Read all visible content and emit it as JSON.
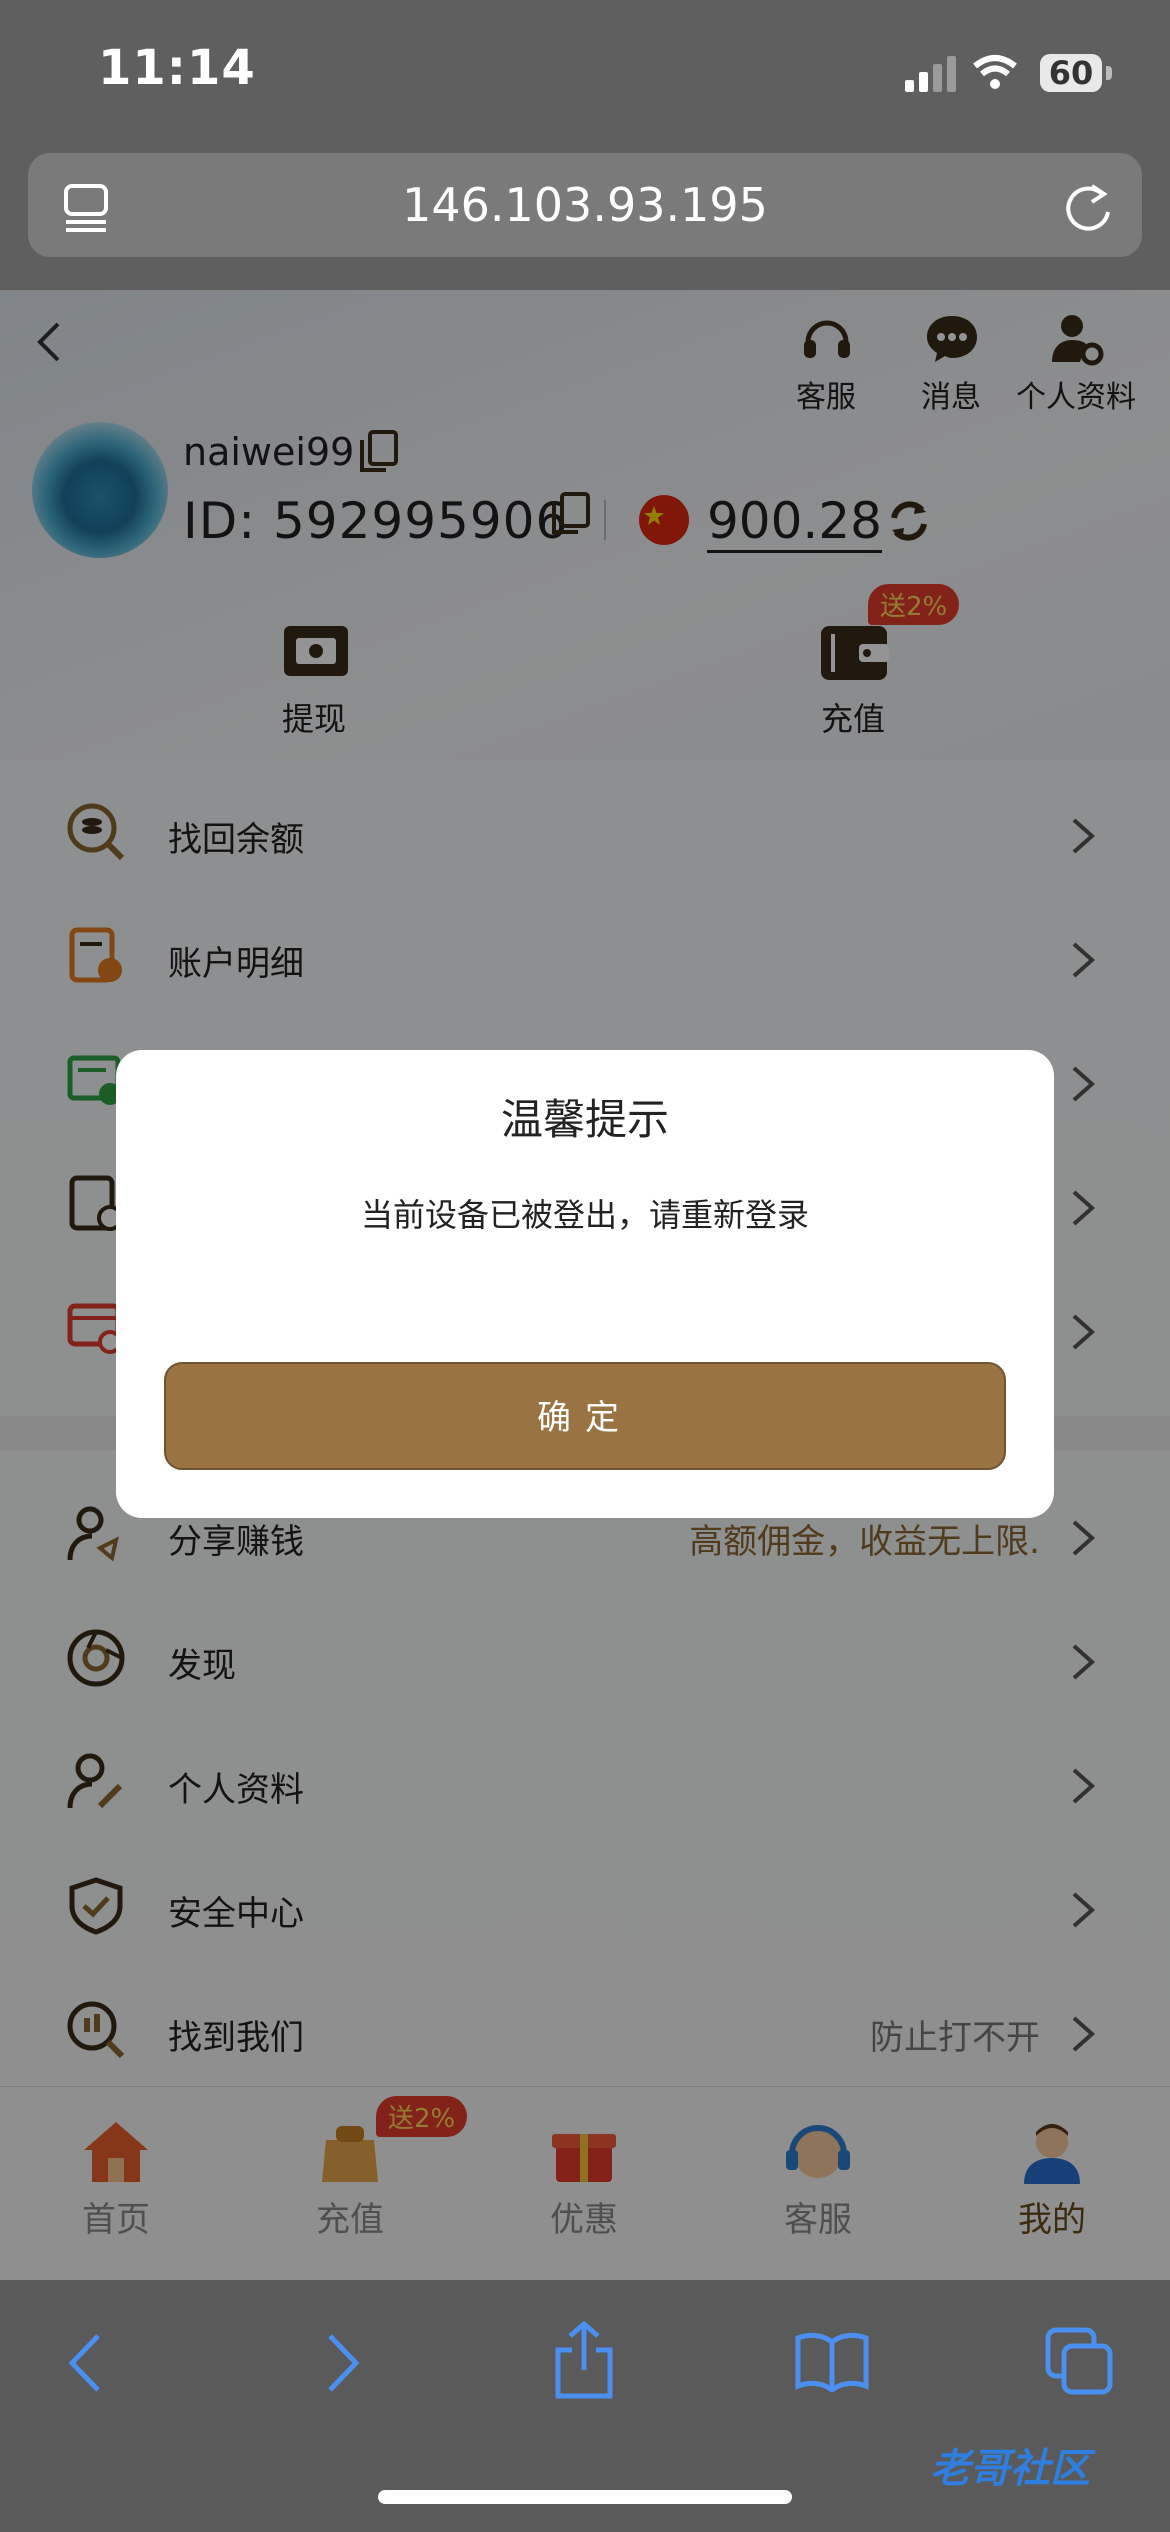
{
  "status": {
    "time": "11:14",
    "battery": "60"
  },
  "browser": {
    "url": "146.103.93.195"
  },
  "header": {
    "actions": [
      {
        "label": "客服",
        "icon": "headset-icon"
      },
      {
        "label": "消息",
        "icon": "chat-bubble-icon"
      },
      {
        "label": "个人资料",
        "icon": "user-gear-icon"
      }
    ]
  },
  "profile": {
    "username": "naiwei99",
    "id_text": "ID: 592995906",
    "balance": "900.28"
  },
  "quick": {
    "withdraw": "提现",
    "deposit": "充值",
    "deposit_badge": "送2%"
  },
  "menu1": [
    {
      "label": "找回余额",
      "icon": "recover-balance-icon"
    },
    {
      "label": "账户明细",
      "icon": "account-detail-icon"
    },
    {
      "label": "",
      "icon": "betting-record-icon"
    },
    {
      "label": "",
      "icon": "report-icon"
    },
    {
      "label": "",
      "icon": "card-settings-icon"
    }
  ],
  "menu2": [
    {
      "label": "分享赚钱",
      "sub": "高额佣金，收益无上限.",
      "icon": "share-earn-icon"
    },
    {
      "label": "发现",
      "sub": "",
      "icon": "discover-icon"
    },
    {
      "label": "个人资料",
      "sub": "",
      "icon": "profile-edit-icon"
    },
    {
      "label": "安全中心",
      "sub": "",
      "icon": "shield-check-icon"
    },
    {
      "label": "找到我们",
      "sub": "防止打不开",
      "icon": "find-us-icon"
    }
  ],
  "tabs": [
    {
      "label": "首页",
      "icon": "home-icon"
    },
    {
      "label": "充值",
      "icon": "deposit-bag-icon",
      "badge": "送2%"
    },
    {
      "label": "优惠",
      "icon": "gift-icon"
    },
    {
      "label": "客服",
      "icon": "support-icon"
    },
    {
      "label": "我的",
      "icon": "me-icon"
    }
  ],
  "dialog": {
    "title": "温馨提示",
    "message": "当前设备已被登出，请重新登录",
    "confirm": "确定"
  },
  "watermark": "老哥社区",
  "colors": {
    "brand": "#9a7342",
    "badge": "#e23b2a"
  }
}
